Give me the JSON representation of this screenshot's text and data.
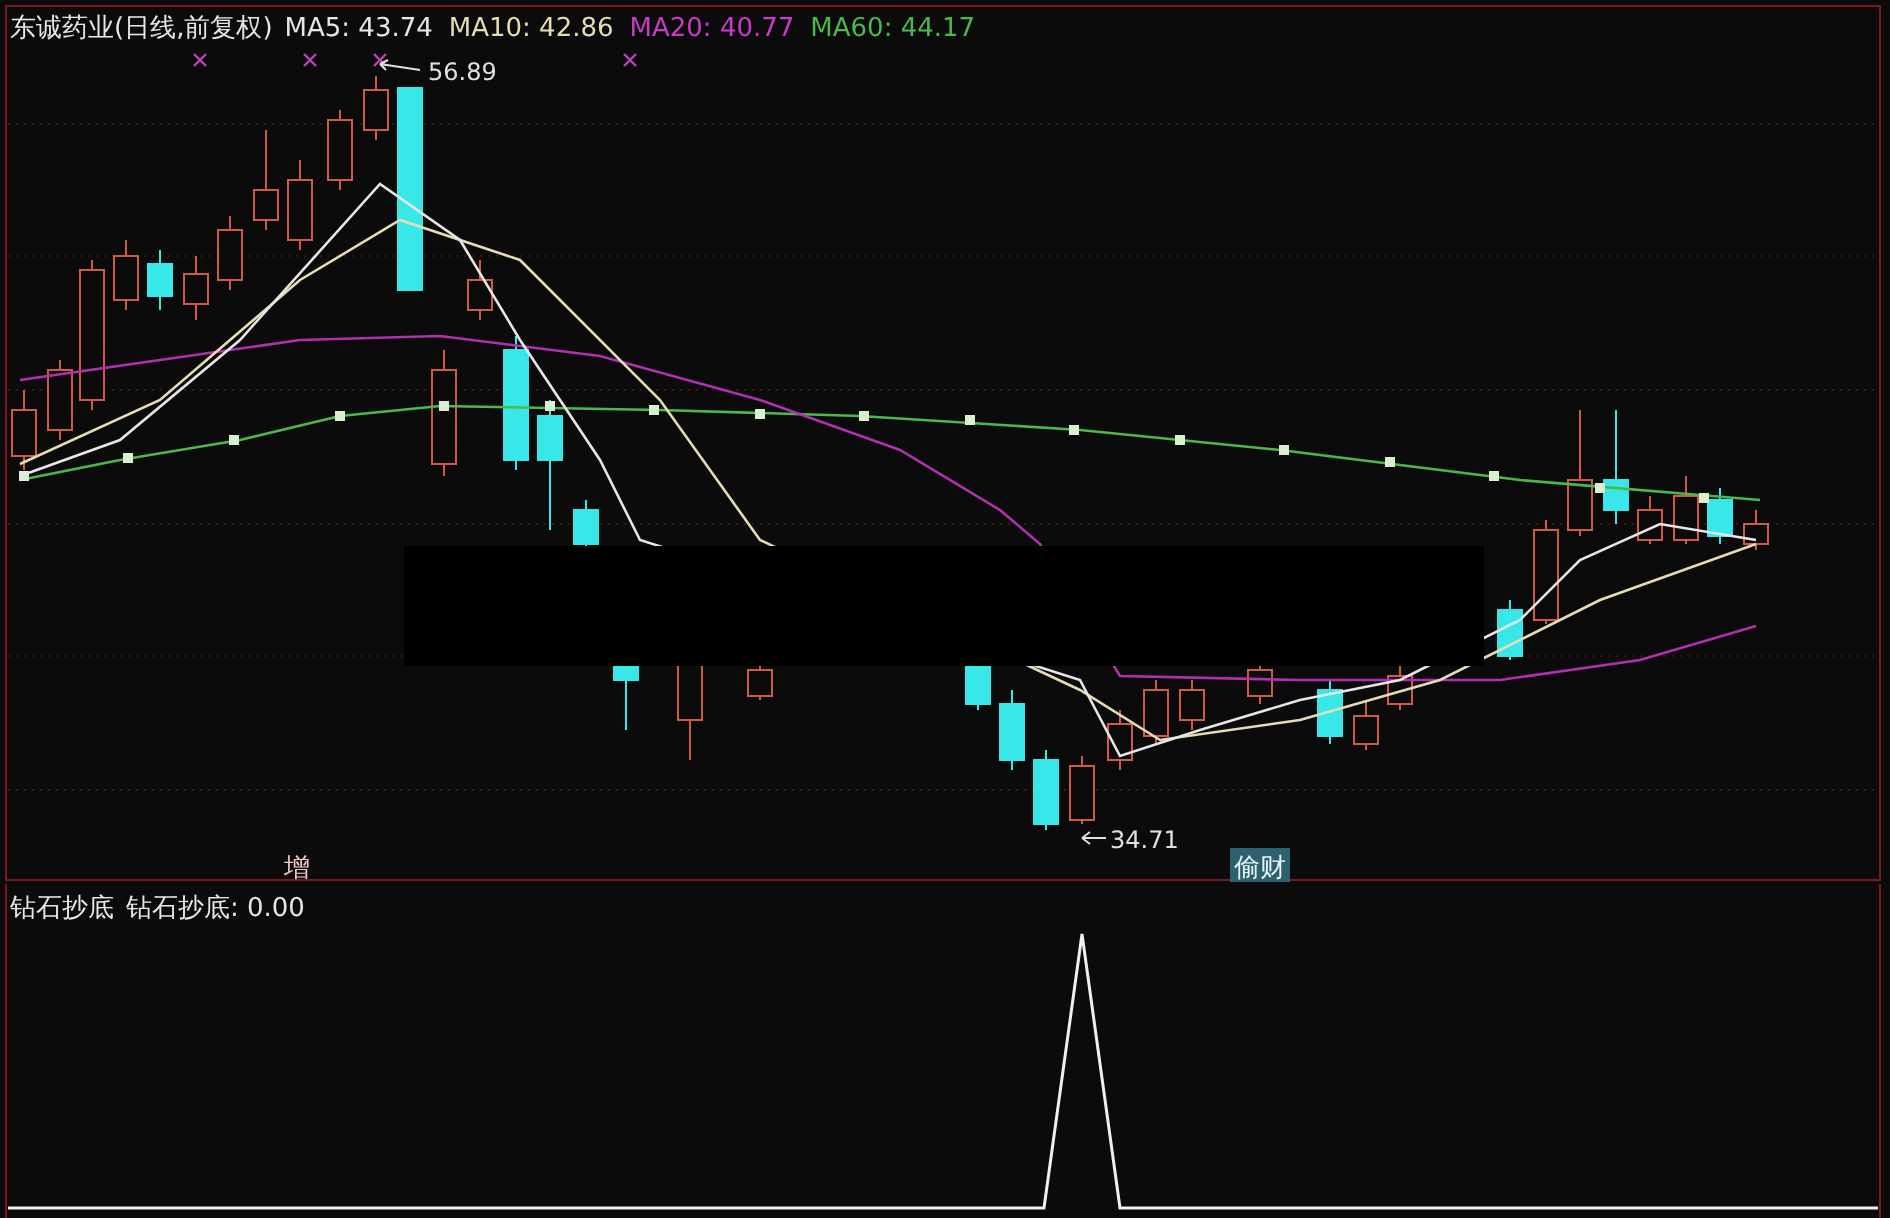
{
  "header": {
    "title": "东诚药业(日线,前复权)",
    "ma": [
      {
        "label": "MA5: 43.74",
        "color": "#e6e6e6"
      },
      {
        "label": "MA10: 42.86",
        "color": "#e6dcb4"
      },
      {
        "label": "MA20: 40.77",
        "color": "#c83cc8"
      },
      {
        "label": "MA60: 44.17",
        "color": "#4cb84c"
      }
    ]
  },
  "price_chart": {
    "high_label": "56.89",
    "low_label": "34.71",
    "signals": [
      {
        "text": "增",
        "kind": "plain"
      },
      {
        "text": "偷财",
        "kind": "boxed"
      }
    ]
  },
  "indicator": {
    "name": "钻石抄底",
    "reading": "钻石抄底: 0.00"
  }
}
